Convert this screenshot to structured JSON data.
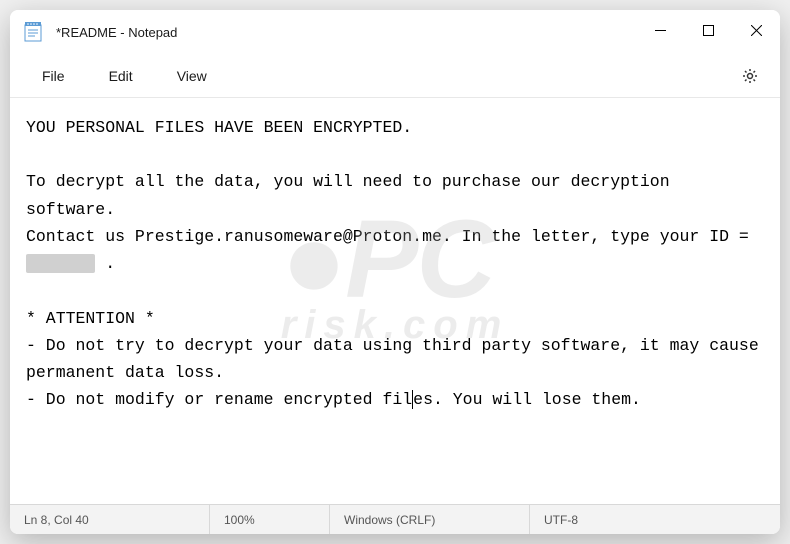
{
  "titlebar": {
    "title": "*README - Notepad"
  },
  "menubar": {
    "file": "File",
    "edit": "Edit",
    "view": "View"
  },
  "content": {
    "line1": "YOU PERSONAL FILES HAVE BEEN ENCRYPTED.",
    "line2": "",
    "line3": "To decrypt all the data, you will need to purchase our decryption software.",
    "line4_pre": "Contact us Prestige.ranusomeware@Proton.me. In the letter, type your ID = ",
    "line4_redacted": "XXXXXXX",
    "line4_post": " .",
    "line5": "",
    "line6": "* ATTENTION *",
    "line7": "- Do not try to decrypt your data using third party software, it may cause permanent data loss.",
    "line8_pre": "- Do not modify or rename encrypted fil",
    "line8_post": "es. You will lose them."
  },
  "statusbar": {
    "position": "Ln 8, Col 40",
    "zoom": "100%",
    "line_ending": "Windows (CRLF)",
    "encoding": "UTF-8"
  }
}
